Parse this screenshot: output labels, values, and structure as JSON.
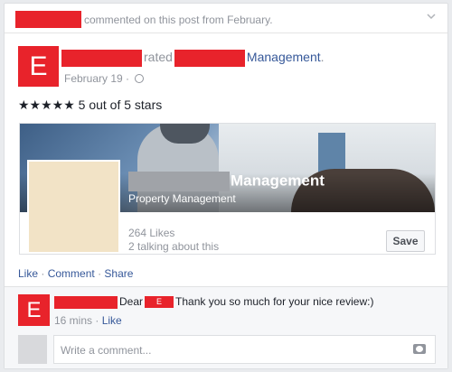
{
  "story": {
    "action_text": "commented on this post from February."
  },
  "post": {
    "avatar_letter": "E",
    "verb": "rated",
    "page_suffix": "Management",
    "date": "February 19",
    "separator": "·",
    "rating": "★★★★★ 5 out of 5 stars"
  },
  "page_card": {
    "name_suffix": "Management",
    "category": "Property Management",
    "likes": "264 Likes",
    "talking": "2 talking about this",
    "save_label": "Save"
  },
  "actions": {
    "like": "Like",
    "comment": "Comment",
    "share": "Share",
    "separator": "·"
  },
  "comment": {
    "avatar_letter": "E",
    "prefix": "Dear",
    "tag_letter": "E",
    "text": "Thank you so much for your nice review:)",
    "time": "16 mins",
    "separator": "·",
    "like": "Like"
  },
  "composer": {
    "placeholder": "Write a comment..."
  },
  "colors": {
    "redaction": "#e8232b",
    "link": "#365899",
    "meta": "#90949c"
  }
}
